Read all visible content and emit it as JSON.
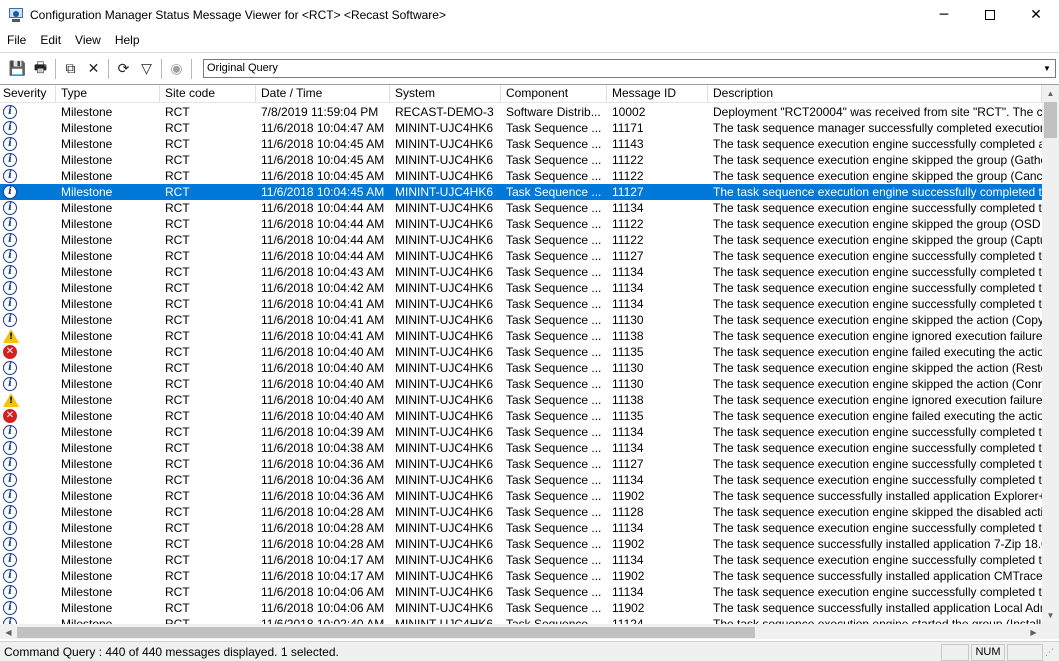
{
  "window": {
    "title": "Configuration Manager Status Message Viewer for <RCT> <Recast Software>",
    "minimize_glyph": "─",
    "close_glyph": "✕"
  },
  "menu": [
    {
      "id": "file",
      "label": "File"
    },
    {
      "id": "edit",
      "label": "Edit"
    },
    {
      "id": "view",
      "label": "View"
    },
    {
      "id": "help",
      "label": "Help"
    }
  ],
  "toolbar": {
    "buttons": [
      {
        "name": "save-icon",
        "glyph": "💾"
      },
      {
        "name": "print-icon",
        "glyph": "🖶"
      },
      {
        "name": "copy-icon",
        "glyph": "⧉"
      },
      {
        "name": "delete-icon",
        "glyph": "✕"
      },
      {
        "name": "refresh-icon",
        "glyph": "⟳"
      },
      {
        "name": "filter-icon",
        "glyph": "▽"
      },
      {
        "name": "stop-icon",
        "glyph": "◉"
      }
    ],
    "query_value": "Original Query",
    "combo_arrow": "▼"
  },
  "columns": [
    "Severity",
    "Type",
    "Site code",
    "Date / Time",
    "System",
    "Component",
    "Message ID",
    "Description"
  ],
  "rows": [
    {
      "sev": "info",
      "type": "Milestone",
      "site": "RCT",
      "date": "7/8/2019 11:59:04 PM",
      "system": "RECAST-DEMO-3",
      "component": "Software Distrib...",
      "msgid": "10002",
      "desc": "Deployment \"RCT20004\" was received from site \"RCT\".    The c"
    },
    {
      "sev": "info",
      "type": "Milestone",
      "site": "RCT",
      "date": "11/6/2018 10:04:47 AM",
      "system": "MININT-UJC4HK6",
      "component": "Task Sequence ...",
      "msgid": "11171",
      "desc": "The task sequence manager successfully completed execution"
    },
    {
      "sev": "info",
      "type": "Milestone",
      "site": "RCT",
      "date": "11/6/2018 10:04:45 AM",
      "system": "MININT-UJC4HK6",
      "component": "Task Sequence ...",
      "msgid": "11143",
      "desc": "The task sequence execution engine successfully completed a"
    },
    {
      "sev": "info",
      "type": "Milestone",
      "site": "RCT",
      "date": "11/6/2018 10:04:45 AM",
      "system": "MININT-UJC4HK6",
      "component": "Task Sequence ...",
      "msgid": "11122",
      "desc": "The task sequence execution engine skipped the group (Gathe"
    },
    {
      "sev": "info",
      "type": "Milestone",
      "site": "RCT",
      "date": "11/6/2018 10:04:45 AM",
      "system": "MININT-UJC4HK6",
      "component": "Task Sequence ...",
      "msgid": "11122",
      "desc": "The task sequence execution engine skipped the group (Cance"
    },
    {
      "sev": "info",
      "type": "Milestone",
      "site": "RCT",
      "date": "11/6/2018 10:04:45 AM",
      "system": "MININT-UJC4HK6",
      "component": "Task Sequence ...",
      "msgid": "11127",
      "desc": "The task sequence execution engine successfully completed th",
      "selected": true
    },
    {
      "sev": "info",
      "type": "Milestone",
      "site": "RCT",
      "date": "11/6/2018 10:04:44 AM",
      "system": "MININT-UJC4HK6",
      "component": "Task Sequence ...",
      "msgid": "11134",
      "desc": "The task sequence execution engine successfully completed th"
    },
    {
      "sev": "info",
      "type": "Milestone",
      "site": "RCT",
      "date": "11/6/2018 10:04:44 AM",
      "system": "MININT-UJC4HK6",
      "component": "Task Sequence ...",
      "msgid": "11122",
      "desc": "The task sequence execution engine skipped the group (OSD R"
    },
    {
      "sev": "info",
      "type": "Milestone",
      "site": "RCT",
      "date": "11/6/2018 10:04:44 AM",
      "system": "MININT-UJC4HK6",
      "component": "Task Sequence ...",
      "msgid": "11122",
      "desc": "The task sequence execution engine skipped the group (Captu"
    },
    {
      "sev": "info",
      "type": "Milestone",
      "site": "RCT",
      "date": "11/6/2018 10:04:44 AM",
      "system": "MININT-UJC4HK6",
      "component": "Task Sequence ...",
      "msgid": "11127",
      "desc": "The task sequence execution engine successfully completed th"
    },
    {
      "sev": "info",
      "type": "Milestone",
      "site": "RCT",
      "date": "11/6/2018 10:04:43 AM",
      "system": "MININT-UJC4HK6",
      "component": "Task Sequence ...",
      "msgid": "11134",
      "desc": "The task sequence execution engine successfully completed th"
    },
    {
      "sev": "info",
      "type": "Milestone",
      "site": "RCT",
      "date": "11/6/2018 10:04:42 AM",
      "system": "MININT-UJC4HK6",
      "component": "Task Sequence ...",
      "msgid": "11134",
      "desc": "The task sequence execution engine successfully completed th"
    },
    {
      "sev": "info",
      "type": "Milestone",
      "site": "RCT",
      "date": "11/6/2018 10:04:41 AM",
      "system": "MININT-UJC4HK6",
      "component": "Task Sequence ...",
      "msgid": "11134",
      "desc": "The task sequence execution engine successfully completed th"
    },
    {
      "sev": "info",
      "type": "Milestone",
      "site": "RCT",
      "date": "11/6/2018 10:04:41 AM",
      "system": "MININT-UJC4HK6",
      "component": "Task Sequence ...",
      "msgid": "11130",
      "desc": "The task sequence execution engine skipped the action (Copy"
    },
    {
      "sev": "warn",
      "type": "Milestone",
      "site": "RCT",
      "date": "11/6/2018 10:04:41 AM",
      "system": "MININT-UJC4HK6",
      "component": "Task Sequence ...",
      "msgid": "11138",
      "desc": "The task sequence execution engine ignored execution failure"
    },
    {
      "sev": "error",
      "type": "Milestone",
      "site": "RCT",
      "date": "11/6/2018 10:04:40 AM",
      "system": "MININT-UJC4HK6",
      "component": "Task Sequence ...",
      "msgid": "11135",
      "desc": "The task sequence execution engine failed executing the action"
    },
    {
      "sev": "info",
      "type": "Milestone",
      "site": "RCT",
      "date": "11/6/2018 10:04:40 AM",
      "system": "MININT-UJC4HK6",
      "component": "Task Sequence ...",
      "msgid": "11130",
      "desc": "The task sequence execution engine skipped the action (Resto"
    },
    {
      "sev": "info",
      "type": "Milestone",
      "site": "RCT",
      "date": "11/6/2018 10:04:40 AM",
      "system": "MININT-UJC4HK6",
      "component": "Task Sequence ...",
      "msgid": "11130",
      "desc": "The task sequence execution engine skipped the action (Conn"
    },
    {
      "sev": "warn",
      "type": "Milestone",
      "site": "RCT",
      "date": "11/6/2018 10:04:40 AM",
      "system": "MININT-UJC4HK6",
      "component": "Task Sequence ...",
      "msgid": "11138",
      "desc": "The task sequence execution engine ignored execution failure"
    },
    {
      "sev": "error",
      "type": "Milestone",
      "site": "RCT",
      "date": "11/6/2018 10:04:40 AM",
      "system": "MININT-UJC4HK6",
      "component": "Task Sequence ...",
      "msgid": "11135",
      "desc": "The task sequence execution engine failed executing the action"
    },
    {
      "sev": "info",
      "type": "Milestone",
      "site": "RCT",
      "date": "11/6/2018 10:04:39 AM",
      "system": "MININT-UJC4HK6",
      "component": "Task Sequence ...",
      "msgid": "11134",
      "desc": "The task sequence execution engine successfully completed th"
    },
    {
      "sev": "info",
      "type": "Milestone",
      "site": "RCT",
      "date": "11/6/2018 10:04:38 AM",
      "system": "MININT-UJC4HK6",
      "component": "Task Sequence ...",
      "msgid": "11134",
      "desc": "The task sequence execution engine successfully completed th"
    },
    {
      "sev": "info",
      "type": "Milestone",
      "site": "RCT",
      "date": "11/6/2018 10:04:36 AM",
      "system": "MININT-UJC4HK6",
      "component": "Task Sequence ...",
      "msgid": "11127",
      "desc": "The task sequence execution engine successfully completed th"
    },
    {
      "sev": "info",
      "type": "Milestone",
      "site": "RCT",
      "date": "11/6/2018 10:04:36 AM",
      "system": "MININT-UJC4HK6",
      "component": "Task Sequence ...",
      "msgid": "11134",
      "desc": "The task sequence execution engine successfully completed th"
    },
    {
      "sev": "info",
      "type": "Milestone",
      "site": "RCT",
      "date": "11/6/2018 10:04:36 AM",
      "system": "MININT-UJC4HK6",
      "component": "Task Sequence ...",
      "msgid": "11902",
      "desc": "The task sequence successfully installed application Explorer++"
    },
    {
      "sev": "info",
      "type": "Milestone",
      "site": "RCT",
      "date": "11/6/2018 10:04:28 AM",
      "system": "MININT-UJC4HK6",
      "component": "Task Sequence ...",
      "msgid": "11128",
      "desc": "The task sequence execution engine skipped the disabled actio"
    },
    {
      "sev": "info",
      "type": "Milestone",
      "site": "RCT",
      "date": "11/6/2018 10:04:28 AM",
      "system": "MININT-UJC4HK6",
      "component": "Task Sequence ...",
      "msgid": "11134",
      "desc": "The task sequence execution engine successfully completed th"
    },
    {
      "sev": "info",
      "type": "Milestone",
      "site": "RCT",
      "date": "11/6/2018 10:04:28 AM",
      "system": "MININT-UJC4HK6",
      "component": "Task Sequence ...",
      "msgid": "11902",
      "desc": "The task sequence successfully installed application 7-Zip 18.0"
    },
    {
      "sev": "info",
      "type": "Milestone",
      "site": "RCT",
      "date": "11/6/2018 10:04:17 AM",
      "system": "MININT-UJC4HK6",
      "component": "Task Sequence ...",
      "msgid": "11134",
      "desc": "The task sequence execution engine successfully completed th"
    },
    {
      "sev": "info",
      "type": "Milestone",
      "site": "RCT",
      "date": "11/6/2018 10:04:17 AM",
      "system": "MININT-UJC4HK6",
      "component": "Task Sequence ...",
      "msgid": "11902",
      "desc": "The task sequence successfully installed application CMTrace("
    },
    {
      "sev": "info",
      "type": "Milestone",
      "site": "RCT",
      "date": "11/6/2018 10:04:06 AM",
      "system": "MININT-UJC4HK6",
      "component": "Task Sequence ...",
      "msgid": "11134",
      "desc": "The task sequence execution engine successfully completed th"
    },
    {
      "sev": "info",
      "type": "Milestone",
      "site": "RCT",
      "date": "11/6/2018 10:04:06 AM",
      "system": "MININT-UJC4HK6",
      "component": "Task Sequence ...",
      "msgid": "11902",
      "desc": "The task sequence successfully installed application Local Adn"
    },
    {
      "sev": "info",
      "type": "Milestone",
      "site": "RCT",
      "date": "11/6/2018 10:02:40 AM",
      "system": "MININT-UJC4HK6",
      "component": "Task Sequence ...",
      "msgid": "11124",
      "desc": "The task sequence execution engine started the group (Install"
    }
  ],
  "scroll": {
    "up_arrow": "▲",
    "down_arrow": "▼",
    "left_arrow": "◀",
    "right_arrow": "▶"
  },
  "status": {
    "text": "Command Query : 440 of 440 messages displayed. 1 selected.",
    "num_indicator": "NUM",
    "grip": "⋰"
  },
  "colors": {
    "selection": "#0078d7",
    "info": "#1a3e8c",
    "error": "#d42020",
    "warning": "#f5c400"
  }
}
